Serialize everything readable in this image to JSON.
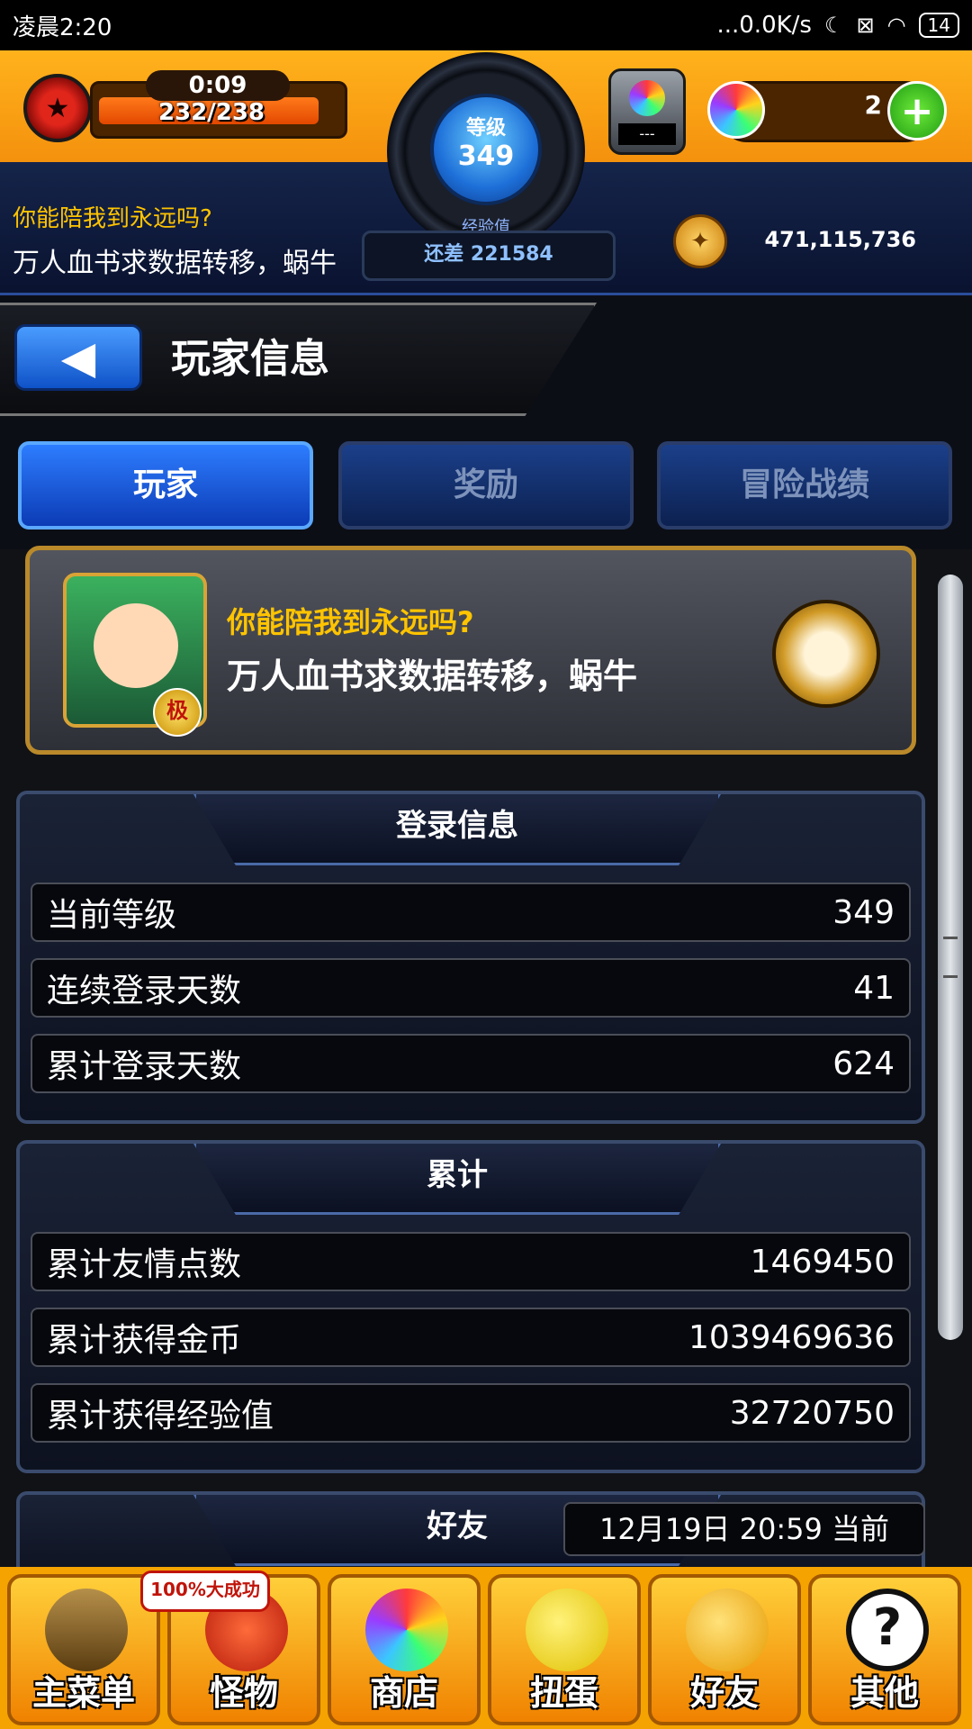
{
  "status_bar": {
    "time": "凌晨2:20",
    "network_speed": "...0.0K/s",
    "battery": "14"
  },
  "header": {
    "stamina_timer": "0:09",
    "stamina": "232/238",
    "stamina_fraction": 0.975,
    "level_label": "等级",
    "level": "349",
    "exp_label": "经验值",
    "exp_remaining": "还差 221584",
    "gacha_label": "---",
    "orb_count": "2",
    "player_line1": "你能陪我到永远吗?",
    "player_line2": "万人血书求数据转移，蜗牛",
    "coins": "471,115,736"
  },
  "title_bar": {
    "title": "玩家信息"
  },
  "tabs": [
    {
      "label": "玩家",
      "active": true
    },
    {
      "label": "奖励",
      "active": false
    },
    {
      "label": "冒险战绩",
      "active": false
    }
  ],
  "profile": {
    "line1": "你能陪我到永远吗?",
    "line2": "万人血书求数据转移，蜗牛",
    "avatar_badge": "极"
  },
  "login_section": {
    "title": "登录信息",
    "rows": [
      {
        "label": "当前等级",
        "value": "349"
      },
      {
        "label": "连续登录天数",
        "value": "41"
      },
      {
        "label": "累计登录天数",
        "value": "624"
      }
    ]
  },
  "total_section": {
    "title": "累计",
    "rows": [
      {
        "label": "累计友情点数",
        "value": "1469450"
      },
      {
        "label": "累计获得金币",
        "value": "1039469636"
      },
      {
        "label": "累计获得经验值",
        "value": "32720750"
      }
    ]
  },
  "friends_section": {
    "title": "好友",
    "timestamp": "12月19日 20:59 当前"
  },
  "bottom_nav": {
    "badge": "100%大成功",
    "items": [
      {
        "label": "主菜单",
        "icon": "gate-icon"
      },
      {
        "label": "怪物",
        "icon": "monster-icon"
      },
      {
        "label": "商店",
        "icon": "rainbow-orb-icon"
      },
      {
        "label": "扭蛋",
        "icon": "egg-icon"
      },
      {
        "label": "好友",
        "icon": "friends-balloon-icon"
      },
      {
        "label": "其他",
        "icon": "question-mark-icon"
      }
    ]
  }
}
